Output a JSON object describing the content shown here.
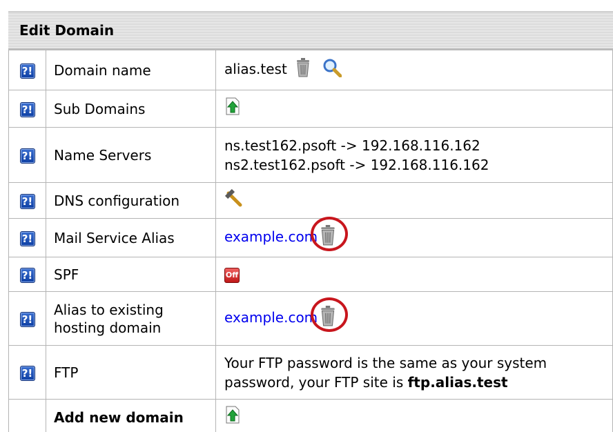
{
  "header": {
    "title": "Edit Domain"
  },
  "help_icon_glyph": "?!",
  "rows": {
    "domain_name": {
      "label": "Domain name",
      "value": "alias.test"
    },
    "sub_domains": {
      "label": "Sub Domains"
    },
    "name_servers": {
      "label": "Name Servers",
      "lines": [
        "ns.test162.psoft -> 192.168.116.162",
        "ns2.test162.psoft -> 192.168.116.162"
      ]
    },
    "dns_configuration": {
      "label": "DNS configuration"
    },
    "mail_service_alias": {
      "label": "Mail Service Alias",
      "value": "example.com"
    },
    "spf": {
      "label": "SPF",
      "toggle": "Off"
    },
    "alias_existing": {
      "label_line1": "Alias to existing",
      "label_line2": "hosting domain",
      "value": "example.com"
    },
    "ftp": {
      "label": "FTP",
      "line1": "Your FTP password is the same as your system",
      "line2_prefix": "password, your FTP site is ",
      "line2_site": "ftp.alias.test"
    },
    "add_new_domain": {
      "label": "Add new domain"
    }
  },
  "colors": {
    "link": "#0000ee",
    "highlight_circle": "#c8161d",
    "help_blue": "#1a4fb8"
  }
}
